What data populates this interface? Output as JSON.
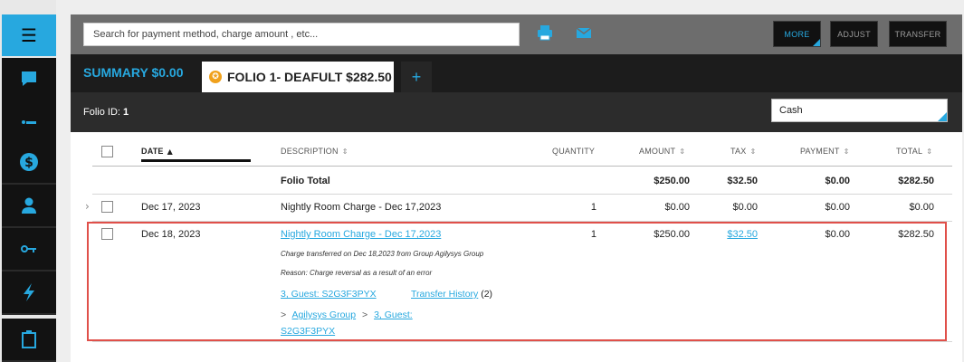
{
  "sidebar": {
    "items": [
      {
        "name": "menu",
        "icon": "☰"
      },
      {
        "name": "messages",
        "icon": "▮"
      },
      {
        "name": "notes",
        "icon": "•—"
      },
      {
        "name": "billing",
        "icon": "$"
      },
      {
        "name": "guest",
        "icon": "👤"
      },
      {
        "name": "keys",
        "icon": "⚿"
      },
      {
        "name": "actions",
        "icon": "ϟ"
      },
      {
        "name": "documents",
        "icon": "⎘"
      }
    ]
  },
  "toolbar": {
    "search_placeholder": "Search for payment method, charge amount , etc...",
    "more_label": "MORE",
    "adjust_label": "ADJUST",
    "transfer_label": "TRANSFER",
    "print_icon": "🖶",
    "mail_icon": "✉"
  },
  "tabs": {
    "summary_label": "SUMMARY $0.00",
    "folio_label": "FOLIO 1- DEAFULT $282.50",
    "add_label": "+"
  },
  "folio": {
    "id_label": "Folio ID:",
    "id_value": "1",
    "payment_method": "Cash"
  },
  "table": {
    "columns": [
      "DATE",
      "DESCRIPTION",
      "QUANTITY",
      "AMOUNT",
      "TAX",
      "PAYMENT",
      "TOTAL"
    ],
    "total_row": {
      "label": "Folio Total",
      "amount": "$250.00",
      "tax": "$32.50",
      "payment": "$0.00",
      "total": "$282.50"
    },
    "rows": [
      {
        "date": "Dec 17, 2023",
        "description": "Nightly Room Charge - Dec 17,2023",
        "quantity": "1",
        "amount": "$0.00",
        "tax": "$0.00",
        "payment": "$0.00",
        "total": "$0.00"
      },
      {
        "date": "Dec 18, 2023",
        "description": "Nightly Room Charge - Dec 17,2023",
        "quantity": "1",
        "amount": "$250.00",
        "tax": "$32.50",
        "payment": "$0.00",
        "total": "$282.50",
        "note1": "Charge transferred on Dec 18,2023 from Group Agilysys Group",
        "note2": "Reason: Charge reversal as a result of an error",
        "guest_link": "3, Guest: S2G3F3PYX",
        "history_link": "Transfer History",
        "history_count": "(2)",
        "crumb_root": "Agilysys Group",
        "crumb_guest_1": "3, Guest:",
        "crumb_guest_2": "S2G3F3PYX"
      }
    ]
  },
  "colors": {
    "accent": "#27a8df",
    "highlight": "#e0504a",
    "rail": "#121212"
  }
}
